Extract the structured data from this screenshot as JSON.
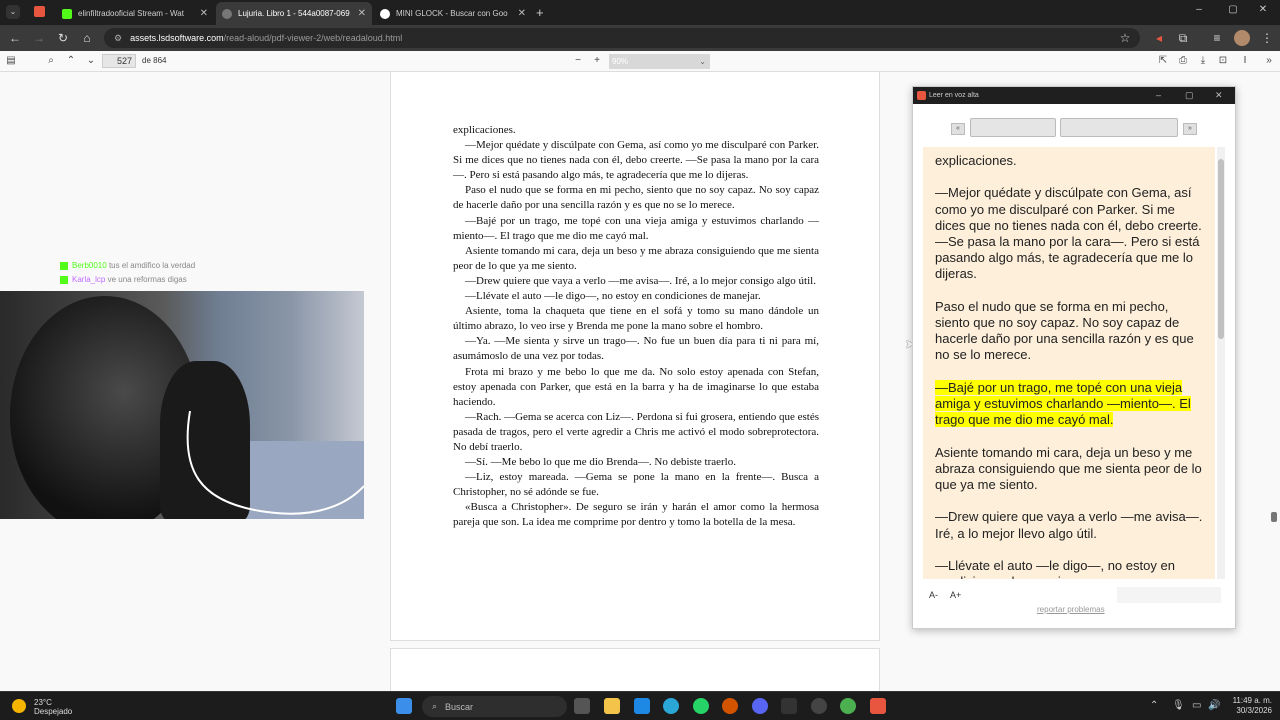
{
  "browser": {
    "tabs": [
      {
        "title": "elinfiltradooficial Stream - Wat",
        "color": "#53fc18"
      },
      {
        "title": "Lujuria. Libro 1 - 544a0087-069",
        "color": "#777777"
      },
      {
        "title": "MINI GLOCK - Buscar con Goo",
        "color": "#ffffff"
      }
    ],
    "url_host": "assets.lsdsoftware.com",
    "url_path": "/read-aloud/pdf-viewer-2/web/readaloud.html"
  },
  "pdf_toolbar": {
    "page_number": "527",
    "page_count": "de 864",
    "zoom": "90%"
  },
  "pdf_page": {
    "paragraphs": [
      "explicaciones.",
      "—Mejor quédate y discúlpate con Gema, así como yo me disculparé con Parker. Si me dices que no tienes nada con él, debo creerte. —Se pasa la mano por la cara—. Pero si está pasando algo más, te agradecería que me lo dijeras.",
      "Paso el nudo que se forma en mi pecho, siento que no soy capaz. No soy capaz de hacerle daño por una sencilla razón y es que no se lo merece.",
      "—Bajé por un trago, me topé con una vieja amiga y estuvimos charlando —miento—. El trago que me dio me cayó mal.",
      "Asiente tomando mi cara, deja un beso y me abraza consiguiendo que me sienta peor de lo que ya me siento.",
      "—Drew quiere que vaya a verlo —me avisa—. Iré, a lo mejor consigo algo útil.",
      "—Llévate el auto —le digo—, no estoy en condiciones de manejar.",
      "Asiente, toma la chaqueta que tiene en el sofá y tomo su mano dándole un último abrazo, lo veo irse y Brenda me pone la mano sobre el hombro.",
      "—Ya. —Me sienta y sirve un trago—. No fue un buen día para ti ni para mí, asumámoslo de una vez por todas.",
      "Frota mi brazo y me bebo lo que me da. No solo estoy apenada con Stefan, estoy apenada con Parker, que está en la barra y ha de imaginarse lo que estaba haciendo.",
      "—Rach. —Gema se acerca con Liz—. Perdona si fui grosera, entiendo que estés pasada de tragos, pero el verte agredir a Chris me activó el modo sobreprotectora. No debí traerlo.",
      "—Sí. —Me bebo lo que me dio Brenda—. No debiste traerlo.",
      "—Liz, estoy mareada. —Gema se pone la mano en la frente—. Busca a Christopher, no sé adónde se fue.",
      "«Busca a Christopher». De seguro se irán y harán el amor como la hermosa pareja que son. La idea me comprime por dentro y tomo la botella de la mesa."
    ]
  },
  "chat": [
    {
      "user": "Berb0010",
      "text": "tus el amdifico la verdad"
    },
    {
      "user": "Karla_lcp",
      "text": "ve una reformas digas"
    }
  ],
  "read_aloud": {
    "title": "Leer en voz alta",
    "prev_label": "«",
    "next_label": "»",
    "paragraphs": [
      {
        "text": "explicaciones.",
        "highlight": false
      },
      {
        "text": "—Mejor quédate y discúlpate con Gema, así como yo me disculparé con Parker. Si me dices que no tienes nada con él, debo creerte. —Se pasa la mano por la cara—. Pero si está pasando algo más, te agradecería que me lo dijeras.",
        "highlight": false
      },
      {
        "text": "Paso el nudo que se forma en mi pecho, siento que no soy capaz. No soy capaz de hacerle daño por una sencilla razón y es que no se lo merece.",
        "highlight": false
      },
      {
        "text": "—Bajé por un trago, me topé con una vieja amiga y estuvimos charlando —miento—. El trago que me dio me cayó mal.",
        "highlight": true
      },
      {
        "text": "Asiente tomando mi cara, deja un beso y me abraza consiguiendo que me sienta peor de lo que ya me siento.",
        "highlight": false
      },
      {
        "text": "—Drew quiere que vaya a verlo —me avisa—. Iré, a lo mejor llevo algo útil.",
        "highlight": false
      },
      {
        "text": "—Llévate el auto —le digo—, no estoy en condiciones de manejar.",
        "highlight": false
      }
    ],
    "font_decrease": "A-",
    "font_increase": "A+",
    "report_link": "reportar problemas"
  },
  "taskbar": {
    "weather_temp": "23°C",
    "weather_desc": "Despejado",
    "search_placeholder": "Buscar",
    "time": "11:49 a. m.",
    "date": "30/3/2026"
  }
}
